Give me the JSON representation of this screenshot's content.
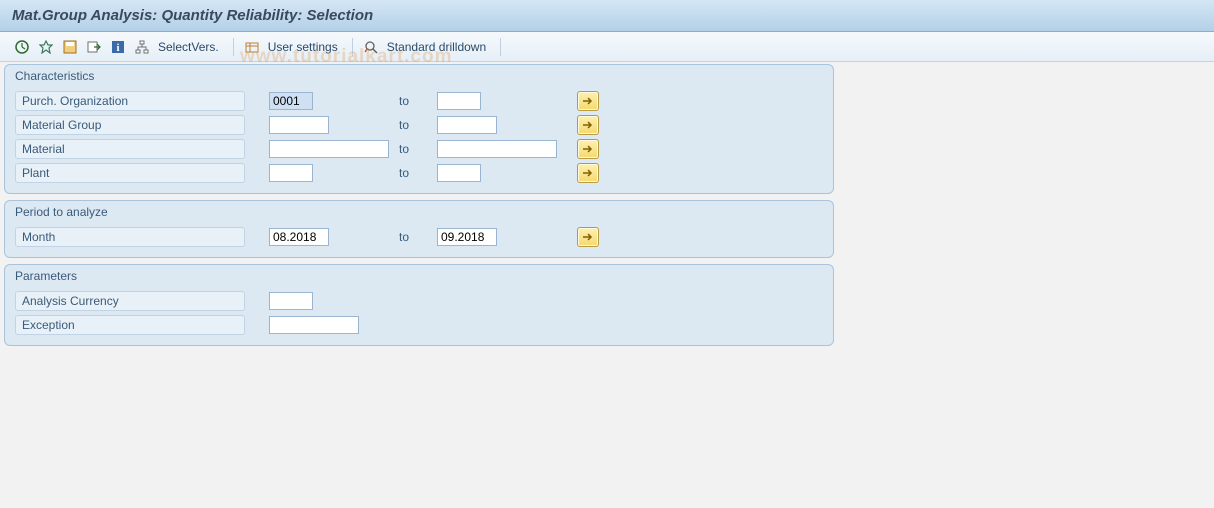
{
  "title": "Mat.Group Analysis: Quantity Reliability: Selection",
  "toolbar": {
    "select_vers": "SelectVers.",
    "user_settings": "User settings",
    "standard_drilldown": "Standard drilldown"
  },
  "groups": {
    "characteristics": {
      "title": "Characteristics",
      "rows": {
        "purch_org": {
          "label": "Purch. Organization",
          "from": "0001",
          "to_label": "to",
          "to": ""
        },
        "material_group": {
          "label": "Material Group",
          "from": "",
          "to_label": "to",
          "to": ""
        },
        "material": {
          "label": "Material",
          "from": "",
          "to_label": "to",
          "to": ""
        },
        "plant": {
          "label": "Plant",
          "from": "",
          "to_label": "to",
          "to": ""
        }
      }
    },
    "period": {
      "title": "Period to analyze",
      "rows": {
        "month": {
          "label": "Month",
          "from": "08.2018",
          "to_label": "to",
          "to": "09.2018"
        }
      }
    },
    "parameters": {
      "title": "Parameters",
      "rows": {
        "analysis_currency": {
          "label": "Analysis Currency",
          "value": ""
        },
        "exception": {
          "label": "Exception",
          "value": ""
        }
      }
    }
  },
  "watermark": "www.tutorialkart.com"
}
